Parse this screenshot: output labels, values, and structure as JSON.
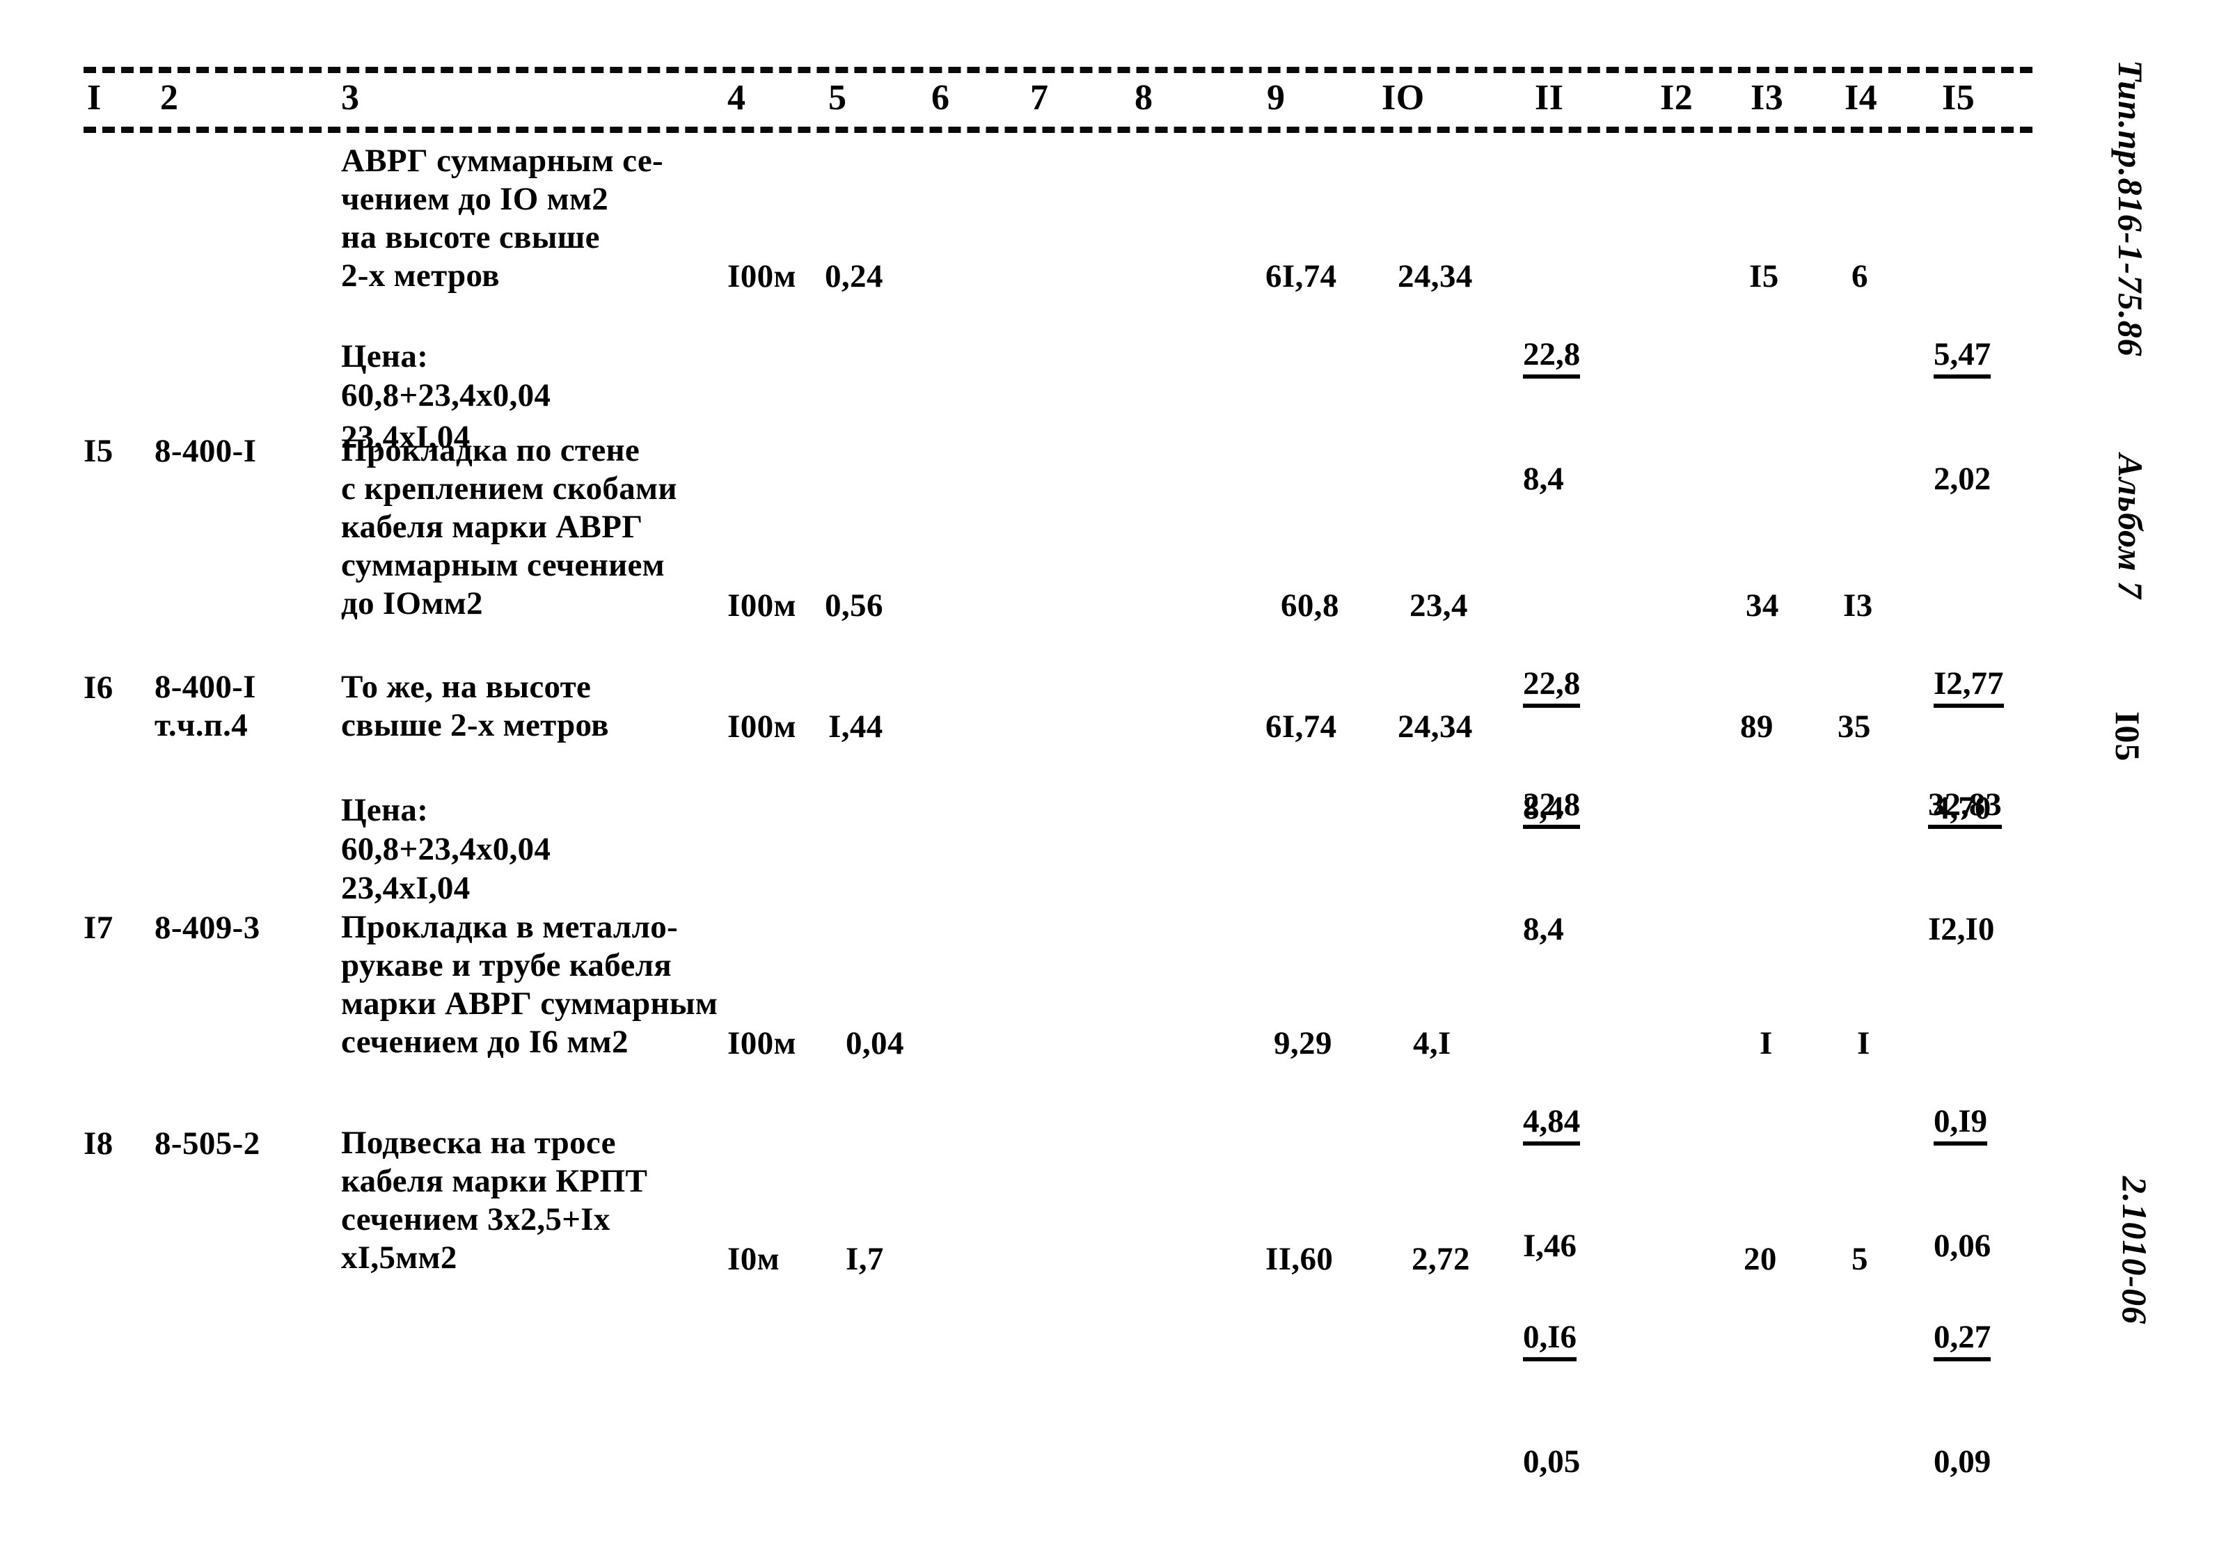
{
  "document": {
    "type": "estimate-table",
    "margin_notes": {
      "doc_code": "Тип.пр.816-1-75.86",
      "album": "Альбом 7",
      "page_number": "I05",
      "sheet_code": "2.1010-06"
    }
  },
  "table": {
    "column_headers": [
      "I",
      "2",
      "3",
      "4",
      "5",
      "6",
      "7",
      "8",
      "9",
      "IO",
      "II",
      "I2",
      "I3",
      "I4",
      "I5"
    ],
    "rows": [
      {
        "no": "",
        "code": "",
        "description": "АВРГ суммарным се-\nчением до IO мм2\nна высоте свыше\n2-х метров",
        "unit": "I00м",
        "qty": "0,24",
        "c9": "6I,74",
        "c10": "24,34",
        "c11_numerator": "22,8",
        "c11_denominator": "8,4",
        "c13": "I5",
        "c14": "6",
        "c15_numerator": "5,47",
        "c15_denominator": "2,02",
        "price_note": "Цена:\n60,8+23,4x0,04",
        "price_note2": "23,4xI,04"
      },
      {
        "no": "I5",
        "code": "8-400-I",
        "description": "Прокладка по стене\nс креплением скобами\nкабеля марки АВРГ\nсуммарным сечением\nдо IOмм2",
        "unit": "I00м",
        "qty": "0,56",
        "c9": "60,8",
        "c10": "23,4",
        "c11_numerator": "22,8",
        "c11_denominator": "8,4",
        "c13": "34",
        "c14": "I3",
        "c15_numerator": "I2,77",
        "c15_denominator": "4,70",
        "price_note": "",
        "price_note2": ""
      },
      {
        "no": "I6",
        "code": "8-400-I\nт.ч.п.4",
        "description": "То же, на высоте\nсвыше 2-х метров",
        "unit": "I00м",
        "qty": "I,44",
        "c9": "6I,74",
        "c10": "24,34",
        "c11_numerator": "22,8",
        "c11_denominator": "8,4",
        "c13": "89",
        "c14": "35",
        "c15_numerator": "32,83",
        "c15_denominator": "I2,I0",
        "price_note": "Цена:\n60,8+23,4x0,04\n23,4xI,04",
        "price_note2": ""
      },
      {
        "no": "I7",
        "code": "8-409-3",
        "description": "Прокладка в металло-\nрукаве и трубе кабеля\nмарки АВРГ суммарным\nсечением до I6 мм2",
        "unit": "I00м",
        "qty": "0,04",
        "c9": "9,29",
        "c10": "4,I",
        "c11_numerator": "4,84",
        "c11_denominator": "I,46",
        "c13": "I",
        "c14": "I",
        "c15_numerator": "0,I9",
        "c15_denominator": "0,06",
        "price_note": "",
        "price_note2": ""
      },
      {
        "no": "I8",
        "code": "8-505-2",
        "description": "Подвеска на тросе\nкабеля марки КРПТ\nсечением 3x2,5+Iх\nхI,5мм2",
        "unit": "I0м",
        "qty": "I,7",
        "c9": "II,60",
        "c10": "2,72",
        "c11_numerator": "0,I6",
        "c11_denominator": "0,05",
        "c13": "20",
        "c14": "5",
        "c15_numerator": "0,27",
        "c15_denominator": "0,09",
        "price_note": "",
        "price_note2": ""
      }
    ]
  }
}
